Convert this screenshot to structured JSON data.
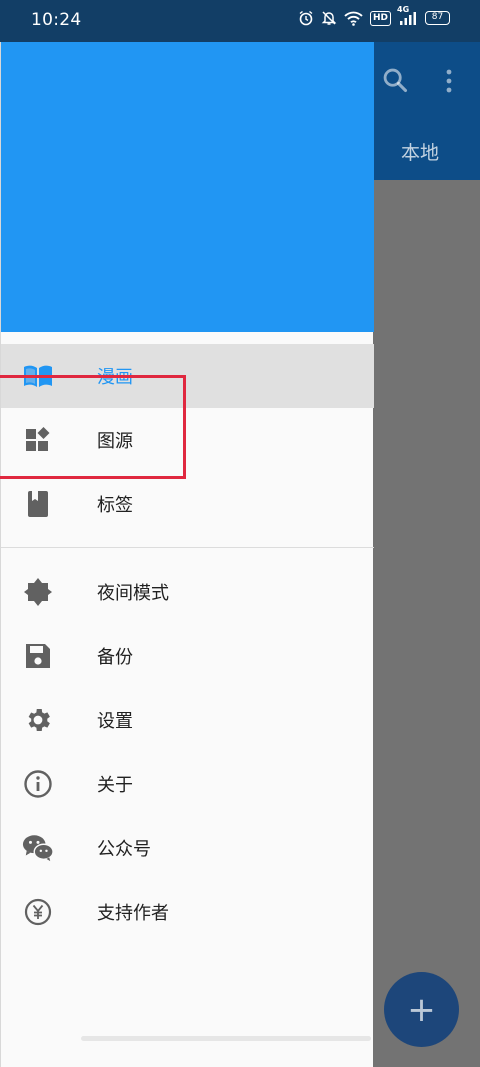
{
  "status_bar": {
    "time": "10:24",
    "hd": "HD",
    "network": "4G",
    "battery": "87"
  },
  "app": {
    "tabs": [
      {
        "label": "本地"
      }
    ],
    "icons": [
      "search-icon",
      "more-vert-icon",
      "add-icon"
    ]
  },
  "drawer": {
    "header_color": "#2196f3",
    "primary_items": [
      {
        "label": "漫画",
        "icon": "book-icon",
        "selected": true
      },
      {
        "label": "图源",
        "icon": "widgets-icon",
        "selected": false
      },
      {
        "label": "标签",
        "icon": "bookmark-icon",
        "selected": false
      }
    ],
    "secondary_items": [
      {
        "label": "夜间模式",
        "icon": "brightness-icon"
      },
      {
        "label": "备份",
        "icon": "save-icon"
      },
      {
        "label": "设置",
        "icon": "settings-icon"
      },
      {
        "label": "关于",
        "icon": "info-icon"
      },
      {
        "label": "公众号",
        "icon": "wechat-icon"
      },
      {
        "label": "支持作者",
        "icon": "yen-icon"
      }
    ]
  },
  "colors": {
    "status_bar": "#123e66",
    "toolbar": "#0d4d88",
    "accent": "#2196f3",
    "highlight": "#e0283f",
    "scrim": "#737373",
    "fab": "#1d467a"
  }
}
